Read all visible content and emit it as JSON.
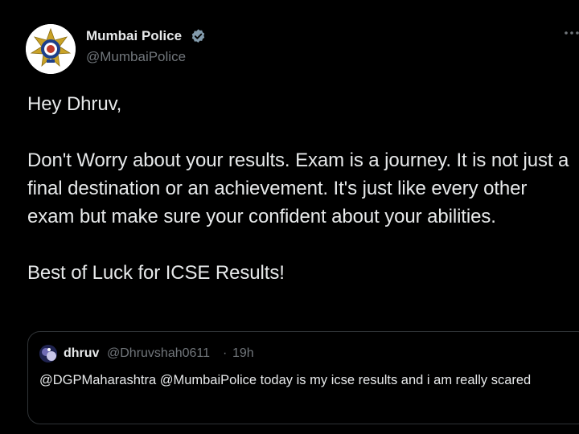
{
  "author": {
    "name": "Mumbai Police",
    "handle": "@MumbaiPolice",
    "verified": true
  },
  "icons": {
    "avatar": "mumbai-police-emblem",
    "verified": "verified-badge-icon",
    "more": "more-options-icon"
  },
  "tweet": {
    "line1": "Hey Dhruv,",
    "line2": "Don't Worry about your results. Exam is a journey. It is not just a final destination or an achievement. It's just like every other exam but make sure your confident about your abilities.",
    "line3": "Best of Luck for ICSE Results!"
  },
  "quote": {
    "name": "dhruv",
    "handle": "@Dhruvshah0611",
    "separator": "·",
    "time": "19h",
    "text": "@DGPMaharashtra @MumbaiPolice today is my icse results and i am really scared"
  },
  "colors": {
    "background": "#000000",
    "text": "#e7e9ea",
    "muted": "#71767b",
    "border": "#2f3336",
    "verified_badge": "#829aab"
  }
}
